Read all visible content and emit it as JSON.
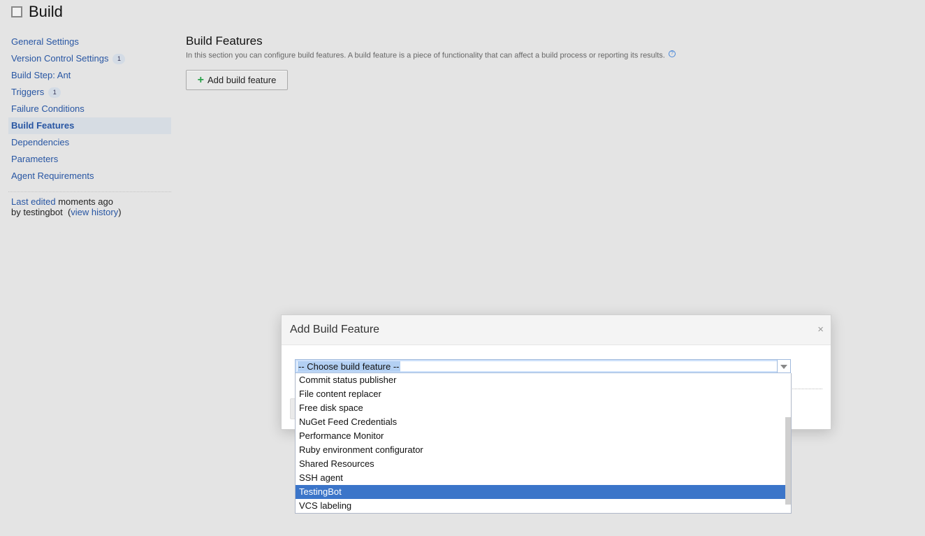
{
  "page": {
    "title": "Build"
  },
  "sidebar": {
    "items": [
      {
        "label": "General Settings",
        "badge": null,
        "active": false
      },
      {
        "label": "Version Control Settings",
        "badge": "1",
        "active": false
      },
      {
        "label": "Build Step: Ant",
        "badge": null,
        "active": false
      },
      {
        "label": "Triggers",
        "badge": "1",
        "active": false
      },
      {
        "label": "Failure Conditions",
        "badge": null,
        "active": false
      },
      {
        "label": "Build Features",
        "badge": null,
        "active": true
      },
      {
        "label": "Dependencies",
        "badge": null,
        "active": false
      },
      {
        "label": "Parameters",
        "badge": null,
        "active": false
      },
      {
        "label": "Agent Requirements",
        "badge": null,
        "active": false
      }
    ],
    "last_edited": {
      "link": "Last edited",
      "when": " moments ago",
      "by": "by testingbot",
      "history_link": "view history"
    }
  },
  "main": {
    "heading": "Build Features",
    "description": "In this section you can configure build features. A build feature is a piece of functionality that can affect a build process or reporting its results.",
    "help_icon": "?",
    "add_button": "Add build feature",
    "add_icon": "+"
  },
  "dialog": {
    "title": "Add Build Feature",
    "close": "×",
    "select": {
      "value": "-- Choose build feature --",
      "options": [
        {
          "label": "Commit status publisher",
          "selected": false
        },
        {
          "label": "File content replacer",
          "selected": false
        },
        {
          "label": "Free disk space",
          "selected": false
        },
        {
          "label": "NuGet Feed Credentials",
          "selected": false
        },
        {
          "label": "Performance Monitor",
          "selected": false
        },
        {
          "label": "Ruby environment configurator",
          "selected": false
        },
        {
          "label": "Shared Resources",
          "selected": false
        },
        {
          "label": "SSH agent",
          "selected": false
        },
        {
          "label": "TestingBot",
          "selected": true
        },
        {
          "label": "VCS labeling",
          "selected": false
        }
      ]
    }
  },
  "colors": {
    "link": "#2856a3",
    "highlight": "#3b75c9",
    "add_icon": "#2aa24a"
  }
}
